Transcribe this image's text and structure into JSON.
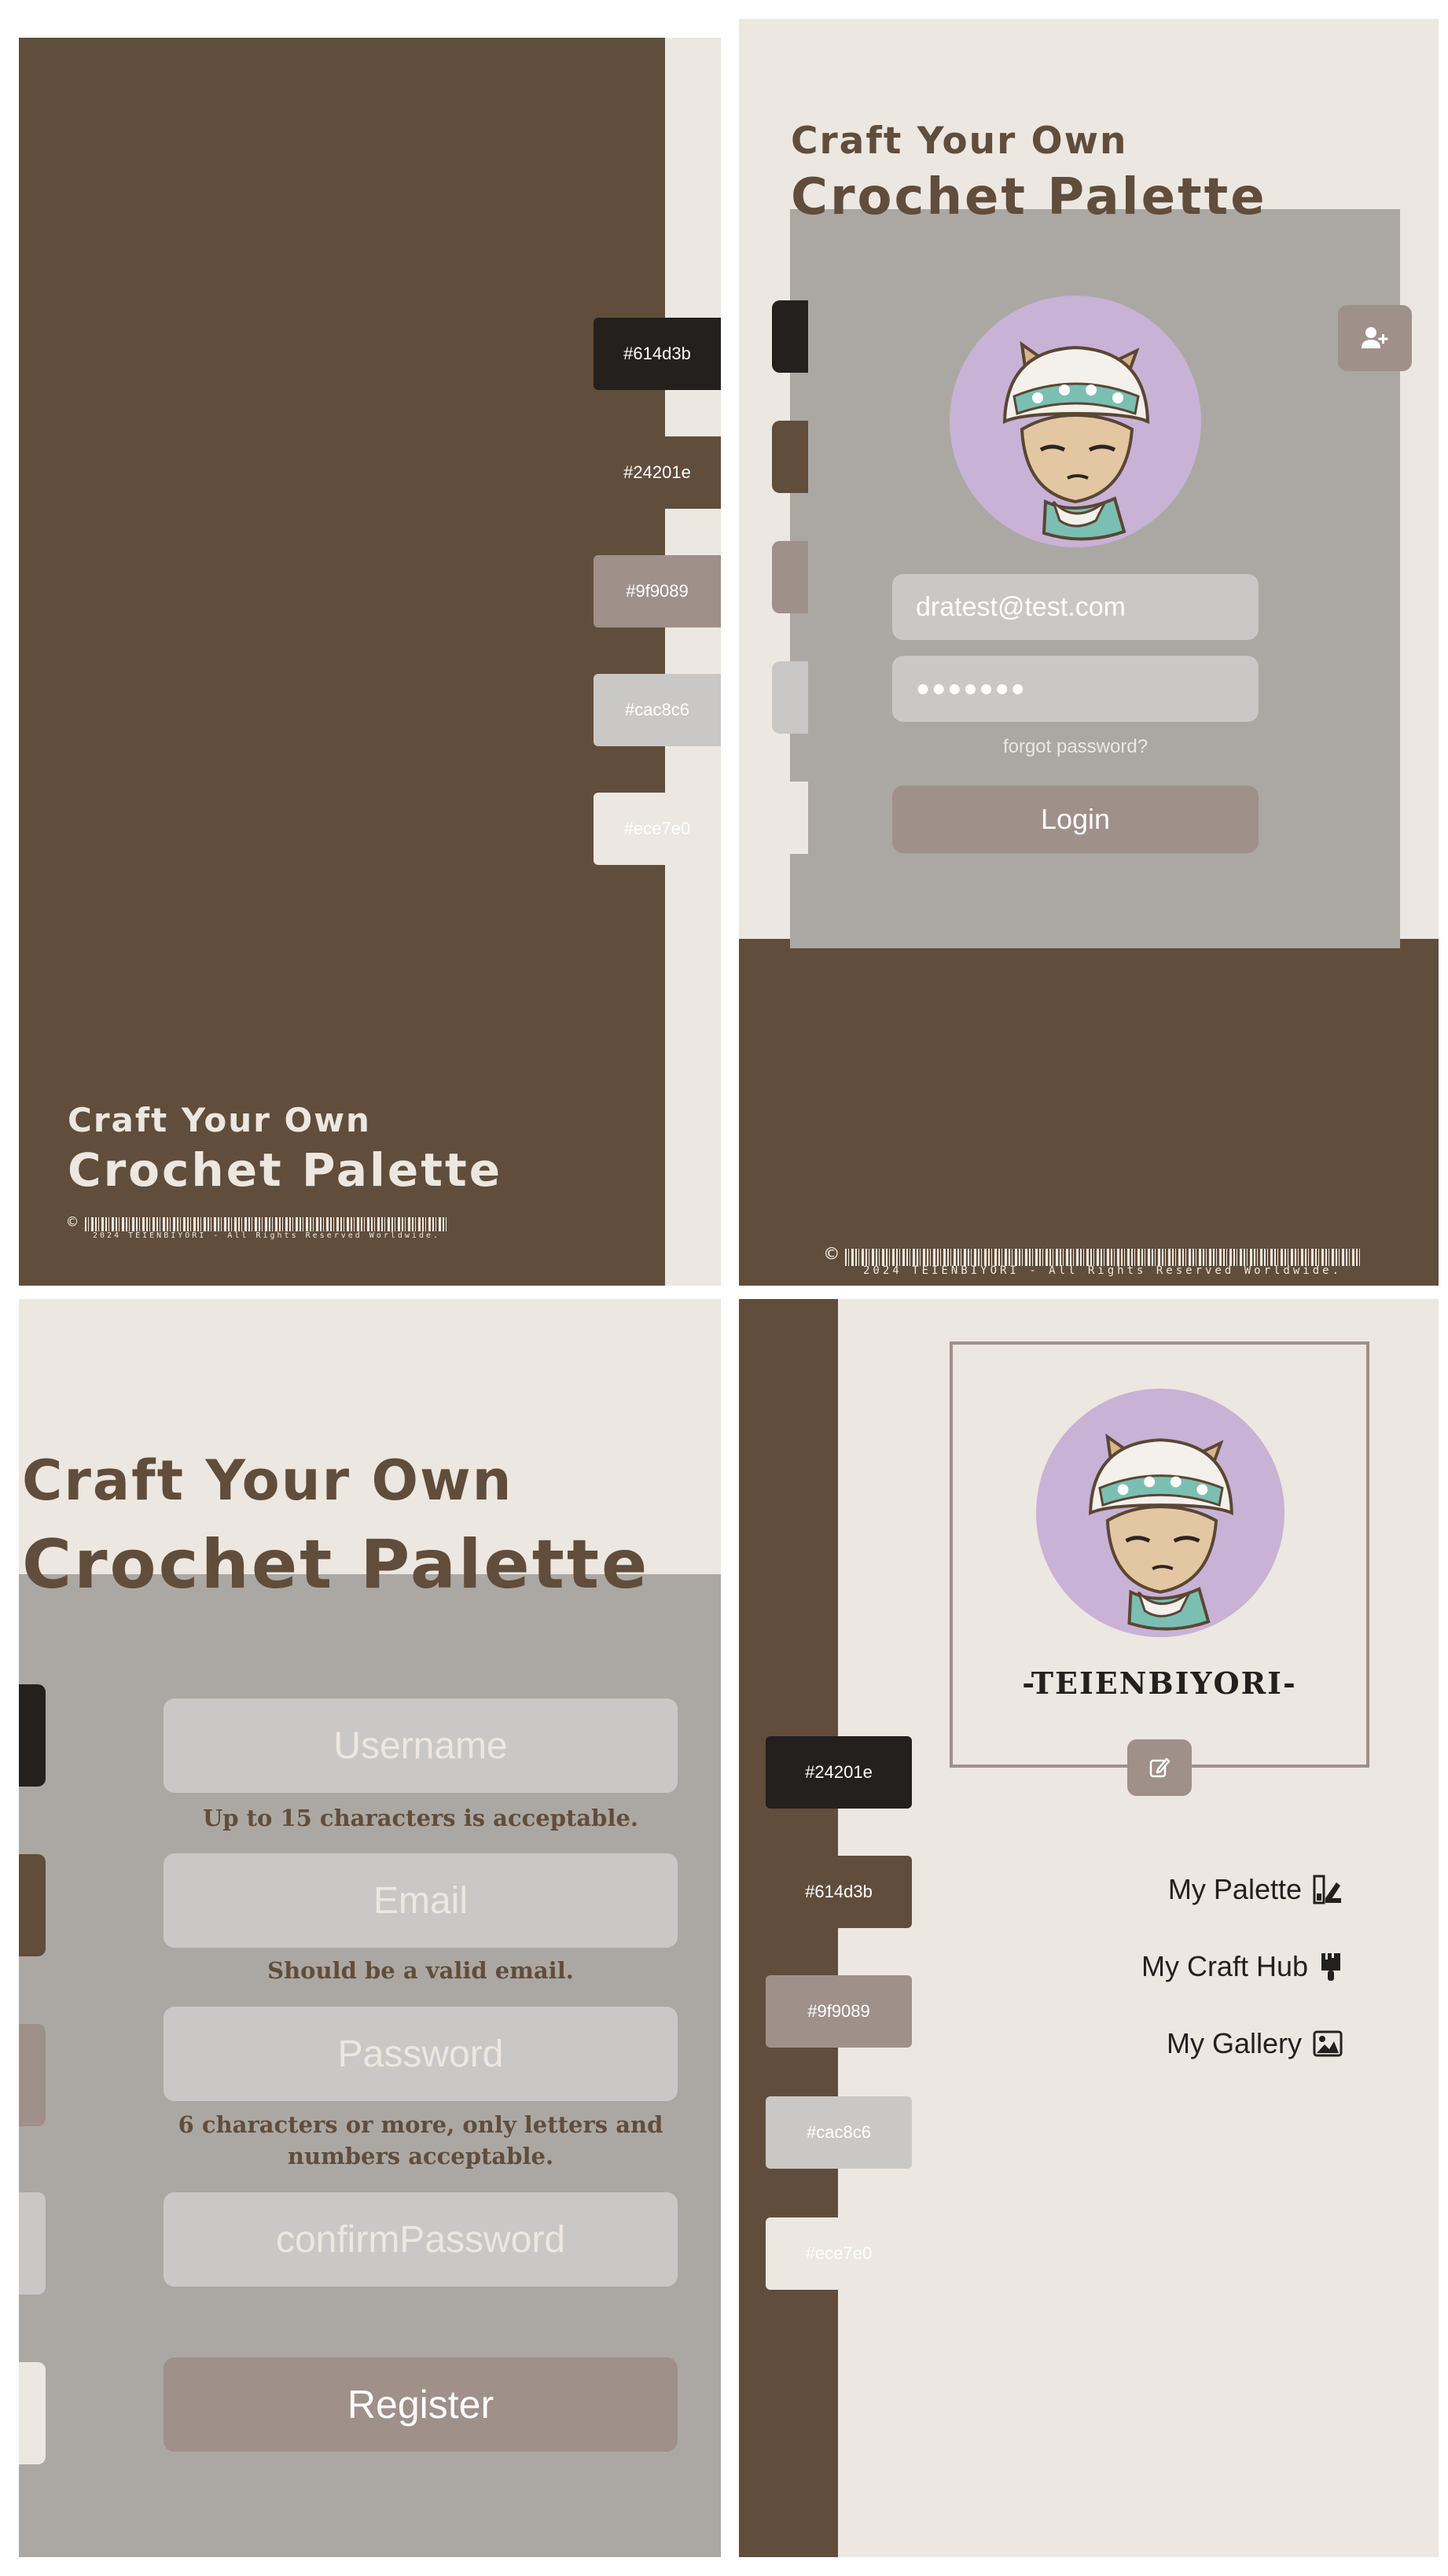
{
  "brand": {
    "line1": "Craft Your Own",
    "line2": "Crochet Palette"
  },
  "copyright": {
    "symbol": "©",
    "text": "2024 TEIENBIYORI - All Rights Reserved Worldwide."
  },
  "colors": {
    "dark_brown": "#614d3b",
    "near_black": "#24201e",
    "taupe": "#9f9089",
    "light_gray": "#cac8c6",
    "cream": "#ece7e0",
    "avatar_bg": "#c8b2d6"
  },
  "splash": {
    "swatches": [
      {
        "label": "#614d3b",
        "color": "#24201e"
      },
      {
        "label": "#24201e",
        "color": "#614d3b"
      },
      {
        "label": "#9f9089",
        "color": "#9f9089"
      },
      {
        "label": "#cac8c6",
        "color": "#cac8c6"
      },
      {
        "label": "#ece7e0",
        "color": "#ece7e0"
      }
    ]
  },
  "login": {
    "email_value": "dratest@test.com",
    "password_value": "●●●●●●●",
    "forgot_link": "forgot password?",
    "login_button": "Login",
    "add_user_icon": "user-plus-icon"
  },
  "register": {
    "username_placeholder": "Username",
    "username_hint": "Up to 15 characters is acceptable.",
    "email_placeholder": "Email",
    "email_hint": "Should be a valid email.",
    "password_placeholder": "Password",
    "password_hint": "6 characters or more, only letters and numbers acceptable.",
    "confirm_placeholder": "confirmPassword",
    "register_button": "Register"
  },
  "profile": {
    "username": "-TEIENBIYORI-",
    "edit_icon": "edit-icon",
    "swatches": [
      {
        "label": "#24201e",
        "color": "#24201e"
      },
      {
        "label": "#614d3b",
        "color": "#614d3b"
      },
      {
        "label": "#9f9089",
        "color": "#9f9089"
      },
      {
        "label": "#cac8c6",
        "color": "#cac8c6"
      },
      {
        "label": "#ece7e0",
        "color": "#ece7e0"
      }
    ],
    "menu": [
      {
        "label": "My Palette",
        "icon": "palette-icon"
      },
      {
        "label": "My Craft Hub",
        "icon": "brush-icon"
      },
      {
        "label": "My Gallery",
        "icon": "image-icon"
      }
    ]
  }
}
